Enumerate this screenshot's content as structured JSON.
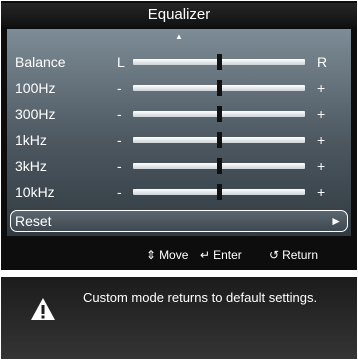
{
  "window": {
    "title": "Equalizer"
  },
  "icons": {
    "scroll_up": "▲",
    "reset_arrow": "►"
  },
  "rows": [
    {
      "label": "Balance",
      "left": "L",
      "right": "R",
      "level": 0.5
    },
    {
      "label": "100Hz",
      "left": "-",
      "right": "+",
      "level": 0.5
    },
    {
      "label": "300Hz",
      "left": "-",
      "right": "+",
      "level": 0.5
    },
    {
      "label": "1kHz",
      "left": "-",
      "right": "+",
      "level": 0.5
    },
    {
      "label": "3kHz",
      "left": "-",
      "right": "+",
      "level": 0.5
    },
    {
      "label": "10kHz",
      "left": "-",
      "right": "+",
      "level": 0.5
    }
  ],
  "reset": {
    "label": "Reset"
  },
  "help": {
    "move": {
      "icon": "⇕",
      "label": "Move"
    },
    "enter": {
      "icon": "↵",
      "label": "Enter"
    },
    "return": {
      "icon": "↺",
      "label": "Return"
    }
  },
  "message": {
    "text": "Custom mode returns to default settings."
  },
  "colors": {
    "track": "#ffffff",
    "thumb": "#111111",
    "panel_top": "#7d8c96",
    "panel_bottom": "#313a40",
    "warning": "#ffffff"
  }
}
